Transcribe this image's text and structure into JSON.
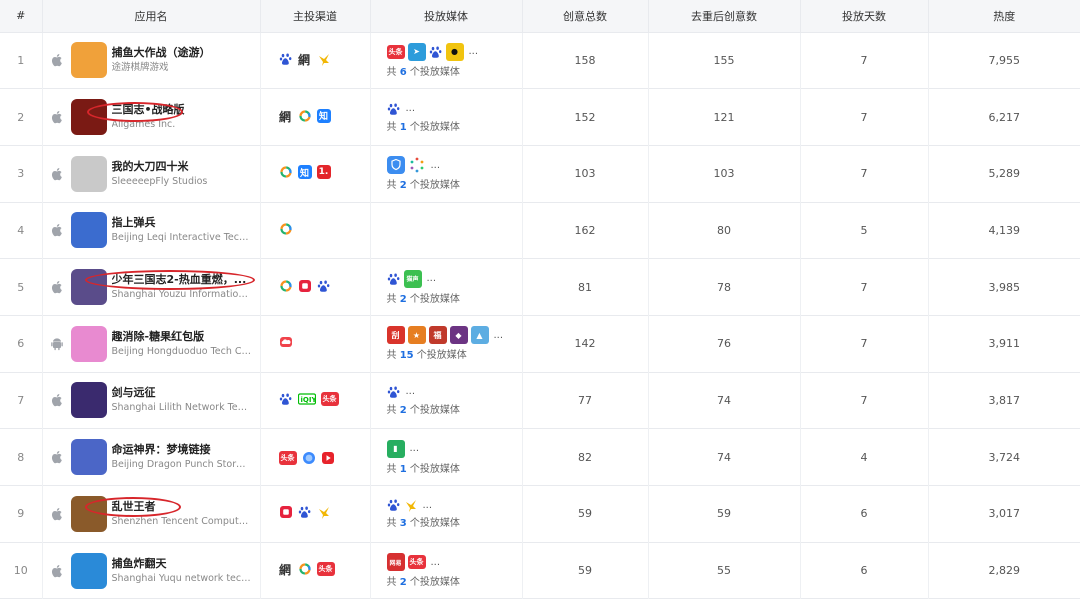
{
  "headers": [
    "#",
    "应用名",
    "主投渠道",
    "投放媒体",
    "创意总数",
    "去重后创意数",
    "投放天数",
    "热度"
  ],
  "media_prefix": "共",
  "media_suffix": "个投放媒体",
  "colors": {
    "highlight_circle": "#d7262b",
    "count_blue": "#1f6fe0",
    "header_bg": "#f5f6f8"
  },
  "rows": [
    {
      "rank": "1",
      "os": "apple-icon",
      "name": "捕鱼大作战（途游）",
      "dev": "途游棋牌游戏",
      "icon_color": "#f0a13a",
      "circled": false,
      "channels": [
        "baidu-icon",
        "wang-icon",
        "yellow-bird-icon"
      ],
      "media": [
        "toutiao-icon",
        "blue-app-icon",
        "baidu-icon",
        "black-cat-icon"
      ],
      "media_more": "...",
      "media_count": "6",
      "creatives": "158",
      "dedup": "155",
      "days": "7",
      "heat": "7,955"
    },
    {
      "rank": "2",
      "os": "apple-icon",
      "name": "三国志•战略版",
      "dev": "Aligames Inc.",
      "icon_color": "#7a1a14",
      "circled": true,
      "channels": [
        "wang-icon",
        "tencent-ring-icon",
        "zhihu-icon"
      ],
      "media": [
        "baidu-icon"
      ],
      "media_more": "...",
      "media_count": "1",
      "creatives": "152",
      "dedup": "121",
      "days": "7",
      "heat": "6,217"
    },
    {
      "rank": "3",
      "os": "apple-icon",
      "name": "我的大刀四十米",
      "dev": "SleeeeepFly Studios",
      "icon_color": "#c9c9c9",
      "circled": false,
      "channels": [
        "tencent-ring-icon",
        "zhihu-icon",
        "one-icon"
      ],
      "media": [
        "shield-icon",
        "colorful-dot-icon"
      ],
      "media_more": "...",
      "media_count": "2",
      "creatives": "103",
      "dedup": "103",
      "days": "7",
      "heat": "5,289"
    },
    {
      "rank": "4",
      "os": "apple-icon",
      "name": "指上弹兵",
      "dev": "Beijing Leqi Interactive Techn...",
      "icon_color": "#3b6ccf",
      "circled": false,
      "channels": [
        "tencent-ring-icon"
      ],
      "media": [],
      "media_more": "",
      "media_count": "",
      "creatives": "162",
      "dedup": "80",
      "days": "5",
      "heat": "4,139"
    },
    {
      "rank": "5",
      "os": "apple-icon",
      "name": "少年三国志2-热血重燃，...",
      "dev": "Shanghai Youzu Information ...",
      "icon_color": "#5a4c8a",
      "circled": true,
      "channels": [
        "tencent-ring-icon",
        "red-square-icon",
        "baidu-icon"
      ],
      "media": [
        "baidu-icon",
        "green-app-icon"
      ],
      "media_more": "...",
      "media_count": "2",
      "creatives": "81",
      "dedup": "78",
      "days": "7",
      "heat": "3,985"
    },
    {
      "rank": "6",
      "os": "android-icon",
      "name": "趣消除-糖果红包版",
      "dev": "Beijing Hongduoduo Tech Co...",
      "icon_color": "#e88ad0",
      "circled": false,
      "channels": [
        "red-cloud-icon"
      ],
      "media": [
        "red-game-icon",
        "orange-game-icon",
        "fu-icon",
        "purple-game-icon",
        "landscape-icon"
      ],
      "media_more": "...",
      "media_count": "15",
      "creatives": "142",
      "dedup": "76",
      "days": "7",
      "heat": "3,911"
    },
    {
      "rank": "7",
      "os": "apple-icon",
      "name": "剑与远征",
      "dev": "Shanghai Lilith Network Tech...",
      "icon_color": "#3a2a6e",
      "circled": false,
      "channels": [
        "baidu-icon",
        "iqiyi-icon",
        "toutiao-icon"
      ],
      "media": [
        "baidu-icon"
      ],
      "media_more": "...",
      "media_count": "2",
      "creatives": "77",
      "dedup": "74",
      "days": "7",
      "heat": "3,817"
    },
    {
      "rank": "8",
      "os": "apple-icon",
      "name": "命运神界：梦境链接",
      "dev": "Beijing Dragon Punch Storm ...",
      "icon_color": "#4b66c7",
      "circled": false,
      "channels": [
        "toutiao-icon",
        "blue-ball-icon",
        "red-play-icon"
      ],
      "media": [
        "green-game-icon"
      ],
      "media_more": "...",
      "media_count": "1",
      "creatives": "82",
      "dedup": "74",
      "days": "4",
      "heat": "3,724"
    },
    {
      "rank": "9",
      "os": "apple-icon",
      "name": "乱世王者",
      "dev": "Shenzhen Tencent Computer...",
      "icon_color": "#8a5a2a",
      "circled": true,
      "channels": [
        "red-square-icon",
        "baidu-icon",
        "yellow-bird-icon"
      ],
      "media": [
        "baidu-icon",
        "yellow-bird-icon"
      ],
      "media_more": "...",
      "media_count": "3",
      "creatives": "59",
      "dedup": "59",
      "days": "6",
      "heat": "3,017"
    },
    {
      "rank": "10",
      "os": "apple-icon",
      "name": "捕鱼炸翻天",
      "dev": "Shanghai Yuqu network tech...",
      "icon_color": "#2a8ad8",
      "circled": false,
      "channels": [
        "wang-icon",
        "tencent-ring-icon",
        "toutiao-icon"
      ],
      "media": [
        "wangyi-icon",
        "toutiao-icon"
      ],
      "media_more": "...",
      "media_count": "2",
      "creatives": "59",
      "dedup": "55",
      "days": "6",
      "heat": "2,829"
    }
  ]
}
